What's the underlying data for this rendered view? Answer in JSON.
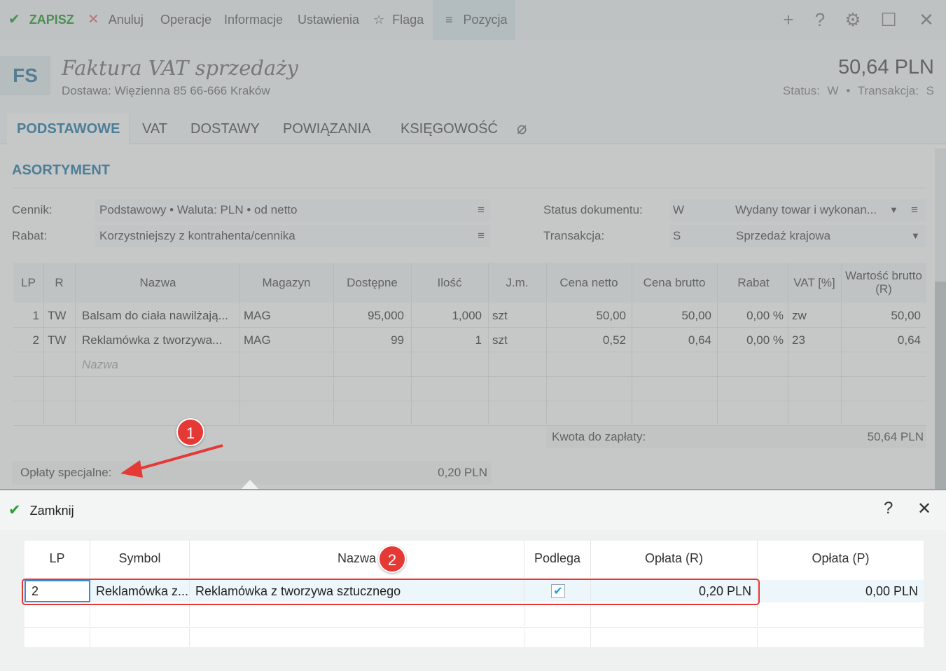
{
  "toolbar": {
    "save": "ZAPISZ",
    "cancel": "Anuluj",
    "operations": "Operacje",
    "info": "Informacje",
    "settings": "Ustawienia",
    "flag": "Flaga",
    "position": "Pozycja"
  },
  "doc": {
    "badge": "FS",
    "title": "Faktura VAT sprzedaży",
    "subtitle": "Dostawa: Więzienna  85  66-666 Kraków",
    "amount": "50,64 PLN",
    "status_label": "Status:",
    "status_value": "W",
    "transaction_label": "Transakcja:",
    "transaction_value": "S"
  },
  "tabs": [
    "PODSTAWOWE",
    "VAT",
    "DOSTAWY",
    "POWIĄZANIA",
    "KSIĘGOWOŚĆ"
  ],
  "section_title": "ASORTYMENT",
  "form": {
    "cennik_label": "Cennik:",
    "cennik_value": "Podstawowy • Waluta: PLN • od netto",
    "rabat_label": "Rabat:",
    "rabat_value": "Korzystniejszy z kontrahenta/cennika",
    "status_label": "Status dokumentu:",
    "status_code": "W",
    "status_value": "Wydany towar i wykonan...",
    "transaction_label": "Transakcja:",
    "transaction_code": "S",
    "transaction_value": "Sprzedaż krajowa"
  },
  "items_grid": {
    "headers": [
      "LP",
      "R",
      "Nazwa",
      "Magazyn",
      "Dostępne",
      "Ilość",
      "J.m.",
      "Cena netto",
      "Cena brutto",
      "Rabat",
      "VAT [%]",
      "Wartość brutto (R)"
    ],
    "rows": [
      [
        "1",
        "TW",
        "Balsam do ciała nawilżają...",
        "MAG",
        "95,000",
        "1,000",
        "szt",
        "50,00",
        "50,00",
        "0,00 %",
        "zw",
        "50,00"
      ],
      [
        "2",
        "TW",
        "Reklamówka z tworzywa...",
        "MAG",
        "99",
        "1",
        "szt",
        "0,52",
        "0,64",
        "0,00 %",
        "23",
        "0,64"
      ]
    ],
    "new_row_placeholder": "Nazwa"
  },
  "totals": {
    "to_pay_label": "Kwota do zapłaty:",
    "to_pay_value": "50,64 PLN",
    "special_fees_label": "Opłaty specjalne:",
    "special_fees_value": "0,20 PLN"
  },
  "panel": {
    "close_label": "Zamknij",
    "help": "?",
    "headers": [
      "LP",
      "Symbol",
      "Nazwa",
      "Podlega",
      "Opłata (R)",
      "Opłata (P)"
    ],
    "rows": [
      {
        "lp": "2",
        "symbol": "Reklamówka z...",
        "nazwa": "Reklamówka z tworzywa sztucznego",
        "podlega": true,
        "oplata_r": "0,20 PLN",
        "oplata_p": "0,00 PLN"
      }
    ]
  },
  "annotations": {
    "badge1": "1",
    "badge2": "2"
  },
  "colors": {
    "accent": "#2f7fa8",
    "save_green": "#2e9c3a",
    "annotation_red": "#e53935",
    "check_blue": "#1ba1e2"
  }
}
